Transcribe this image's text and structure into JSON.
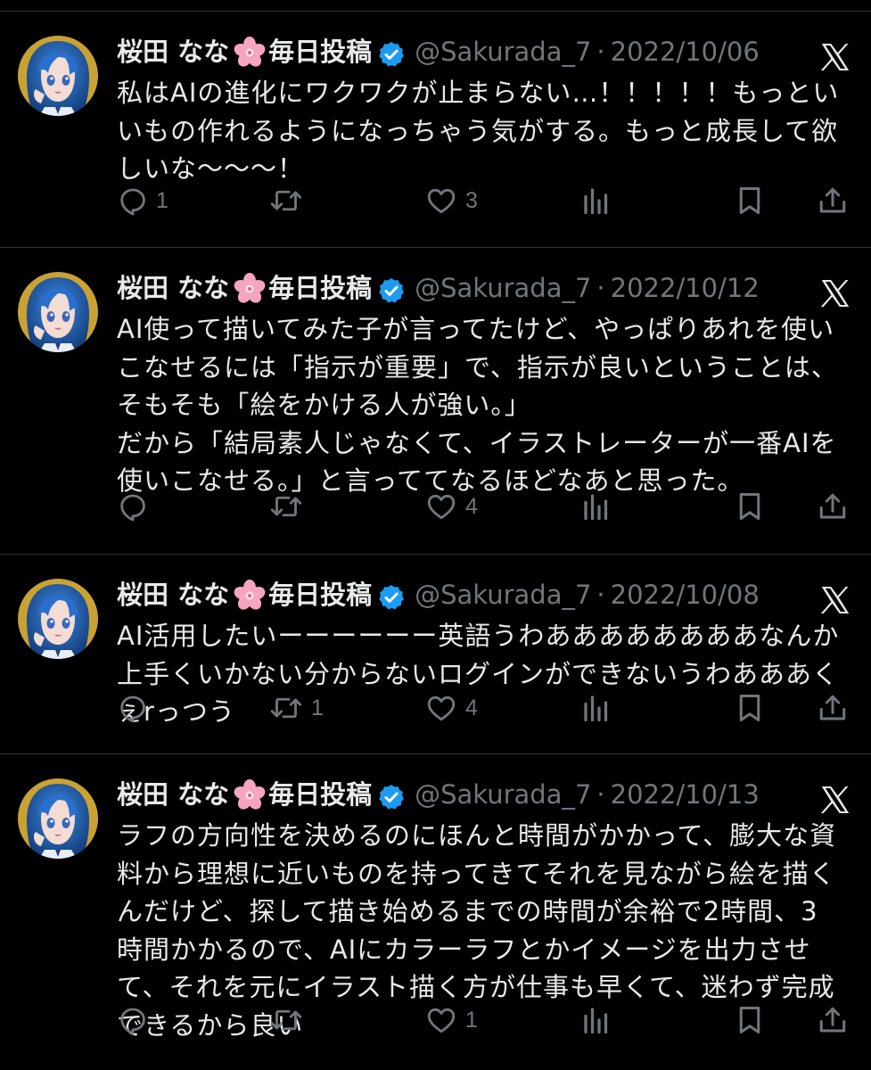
{
  "tweets": [
    {
      "display_name": "桜田 なな",
      "emoji": "🌸",
      "suffix": "毎日投稿",
      "handle": "@Sakurada_7",
      "separator": "·",
      "date": "2022/10/06",
      "text": "私はAIの進化にワクワクが止まらない…！！！！！もっといいもの作れるようになっちゃう気がする。もっと成長して欲しいな〜〜〜！",
      "replies": "1",
      "retweets": "",
      "likes": "3"
    },
    {
      "display_name": "桜田 なな",
      "emoji": "🌸",
      "suffix": "毎日投稿",
      "handle": "@Sakurada_7",
      "separator": "·",
      "date": "2022/10/12",
      "text": "AI使って描いてみた子が言ってたけど、やっぱりあれを使いこなせるには「指示が重要」で、指示が良いということは、そもそも「絵をかける人が強い。」\nだから「結局素人じゃなくて、イラストレーターが一番AIを使いこなせる。」と言っててなるほどなあと思った。",
      "replies": "",
      "retweets": "",
      "likes": "4"
    },
    {
      "display_name": "桜田 なな",
      "emoji": "🌸",
      "suffix": "毎日投稿",
      "handle": "@Sakurada_7",
      "separator": "·",
      "date": "2022/10/08",
      "text": "AI活用したいーーーーーー英語うわああああああああなんか上手くいかない分からないログインができないうわあああくぇrっつう",
      "replies": "",
      "retweets": "1",
      "likes": "4"
    },
    {
      "display_name": "桜田 なな",
      "emoji": "🌸",
      "suffix": "毎日投稿",
      "handle": "@Sakurada_7",
      "separator": "·",
      "date": "2022/10/13",
      "text": "ラフの方向性を決めるのにほんと時間がかかって、膨大な資料から理想に近いものを持ってきてそれを見ながら絵を描くんだけど、探して描き始めるまでの時間が余裕で2時間、3時間かかるので、AIにカラーラフとかイメージを出力させて、それを元にイラスト描く方が仕事も早くて、迷わず完成できるから良い",
      "replies": "",
      "retweets": "",
      "likes": "1"
    }
  ],
  "icons": {
    "avatar": "anime-girl-blue-hair-avatar",
    "verified": "verified-badge-icon",
    "brand": "x-logo-icon",
    "reply": "reply-icon",
    "retweet": "retweet-icon",
    "like": "heart-icon",
    "views": "views-icon",
    "bookmark": "bookmark-icon",
    "share": "share-icon"
  },
  "colors": {
    "background": "#000000",
    "text": "#e7e9ea",
    "muted": "#71767b",
    "divider": "#2f3336",
    "verified": "#1d9bf0"
  }
}
